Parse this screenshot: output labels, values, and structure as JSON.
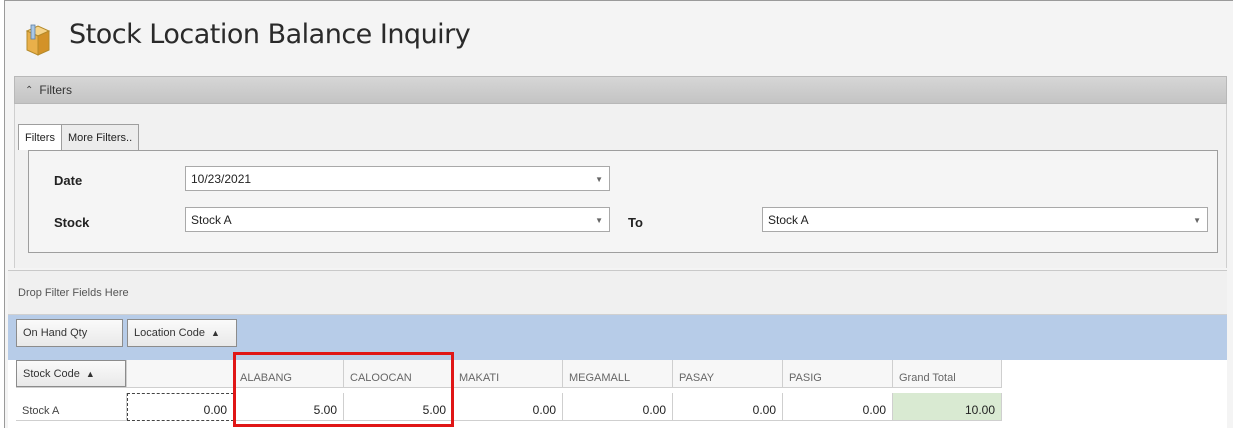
{
  "page": {
    "title": "Stock Location Balance Inquiry"
  },
  "filters": {
    "section_label": "Filters",
    "tabs": [
      "Filters",
      "More Filters.."
    ],
    "date_label": "Date",
    "date_value": "10/23/2021",
    "stock_label": "Stock",
    "stock_from": "Stock A",
    "to_label": "To",
    "stock_to": "Stock A"
  },
  "pivot": {
    "drop_hint": "Drop Filter Fields Here",
    "data_field": "On Hand Qty",
    "column_field": "Location Code",
    "row_field": "Stock Code",
    "columns": [
      "",
      "ALABANG",
      "CALOOCAN",
      "MAKATI",
      "MEGAMALL",
      "PASAY",
      "PASIG",
      "Grand Total"
    ],
    "rows": [
      {
        "label": "Stock A",
        "values": [
          "0.00",
          "5.00",
          "5.00",
          "0.00",
          "0.00",
          "0.00",
          "0.00",
          "10.00"
        ]
      }
    ]
  },
  "colors": {
    "accent_header": "#b7cce8",
    "grand_total_bg": "#d9ead2",
    "highlight": "#e01616"
  }
}
